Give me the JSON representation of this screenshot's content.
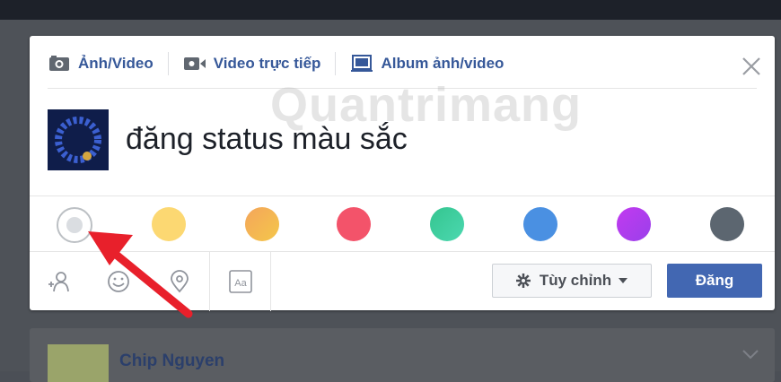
{
  "composer": {
    "tabs": [
      {
        "label": "Ảnh/Video",
        "icon": "camera-icon"
      },
      {
        "label": "Video trực tiếp",
        "icon": "video-camera-icon"
      },
      {
        "label": "Album ảnh/video",
        "icon": "album-icon"
      }
    ],
    "status_text": "đăng status màu sắc",
    "background_colors": [
      "#ffffff",
      "#fcd872",
      "#f5a45b",
      "#f3536a",
      "#42cf9f",
      "#4a90e2",
      "#b040f0",
      "#5c6670"
    ],
    "actions": [
      {
        "icon": "tag-friends-icon"
      },
      {
        "icon": "emoji-icon"
      },
      {
        "icon": "location-pin-icon"
      },
      {
        "icon": "text-format-icon",
        "label": "Aa"
      }
    ],
    "privacy_label": "Tùy chỉnh",
    "post_label": "Đăng"
  },
  "watermark": "Quantrimang",
  "feed": {
    "author": "Chip Nguyen"
  }
}
